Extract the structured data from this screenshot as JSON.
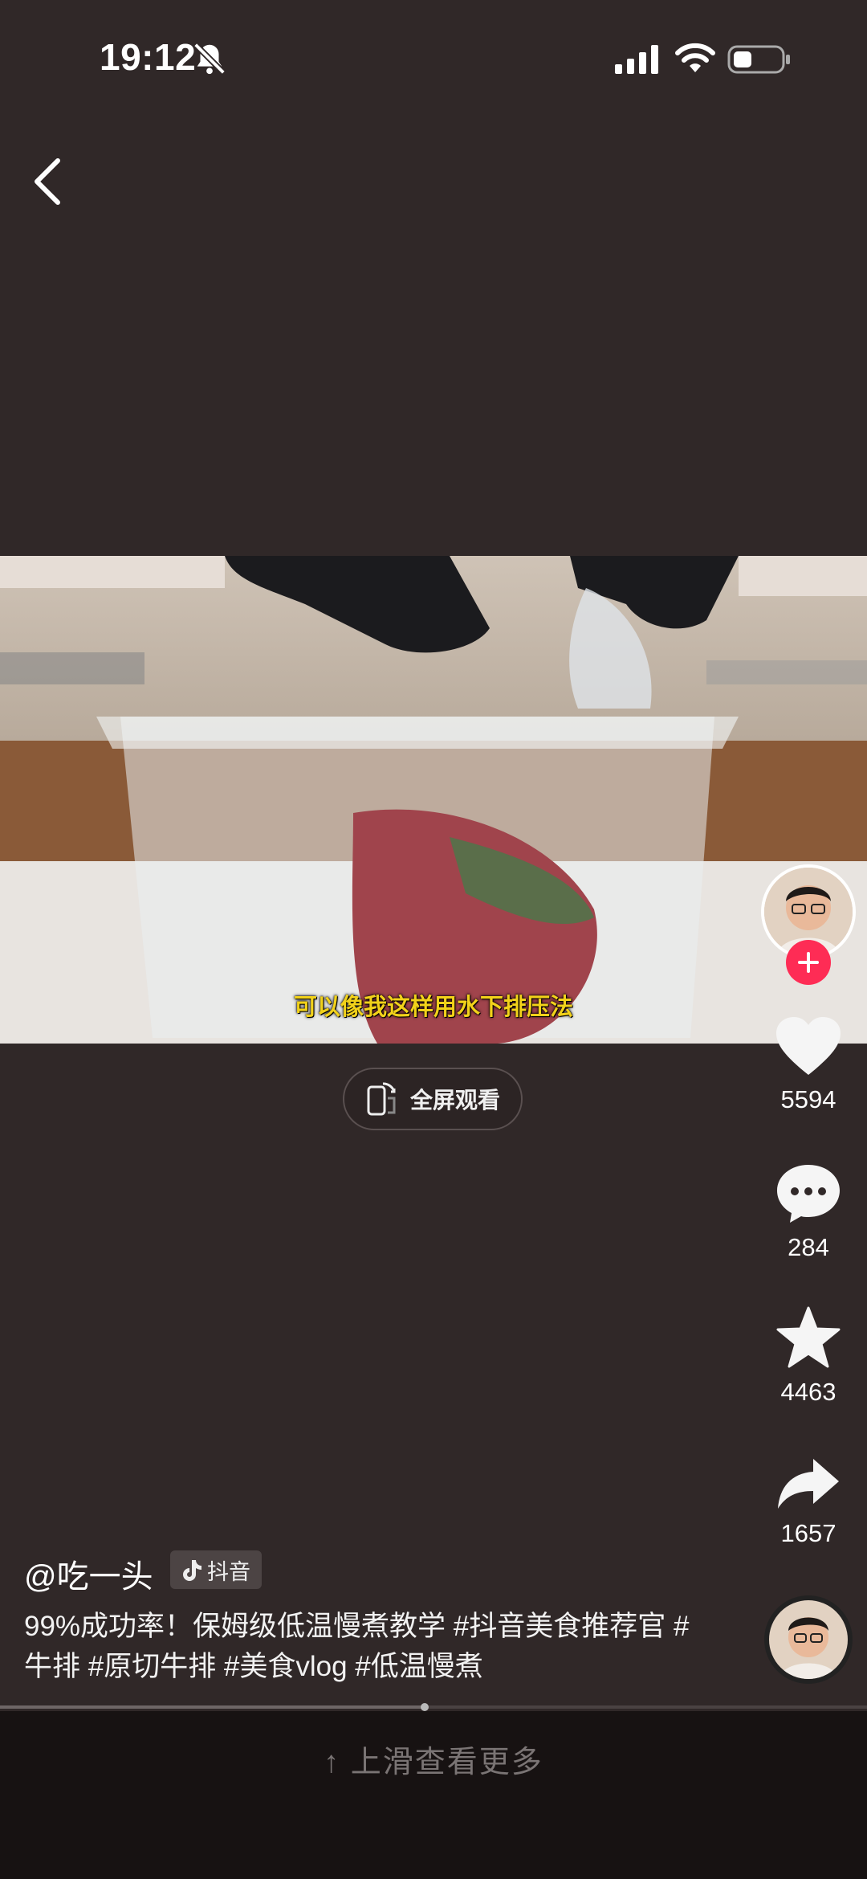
{
  "status_bar": {
    "time": "19:12",
    "icons": [
      "mute-icon",
      "signal-icon",
      "wifi-icon",
      "battery-icon"
    ]
  },
  "nav": {
    "back_icon": "chevron-left-icon"
  },
  "video": {
    "subtitle": "可以像我这样用水下排压法",
    "progress_percent": 49
  },
  "fullscreen_button": {
    "label": "全屏观看",
    "icon": "rotate-phone-icon"
  },
  "actions": {
    "likes": "5594",
    "comments": "284",
    "favorites": "4463",
    "shares": "1657"
  },
  "post": {
    "author": "@吃一头",
    "source_tag": "抖音",
    "caption": "99%成功率！保姆级低温慢煮教学 #抖音美食推荐官 #牛排 #原切牛排 #美食vlog #低温慢煮"
  },
  "footer": {
    "swipe_hint": "上滑查看更多"
  },
  "colors": {
    "background": "#302828",
    "accent": "#fe2c55",
    "subtitle": "#f2d21a"
  }
}
